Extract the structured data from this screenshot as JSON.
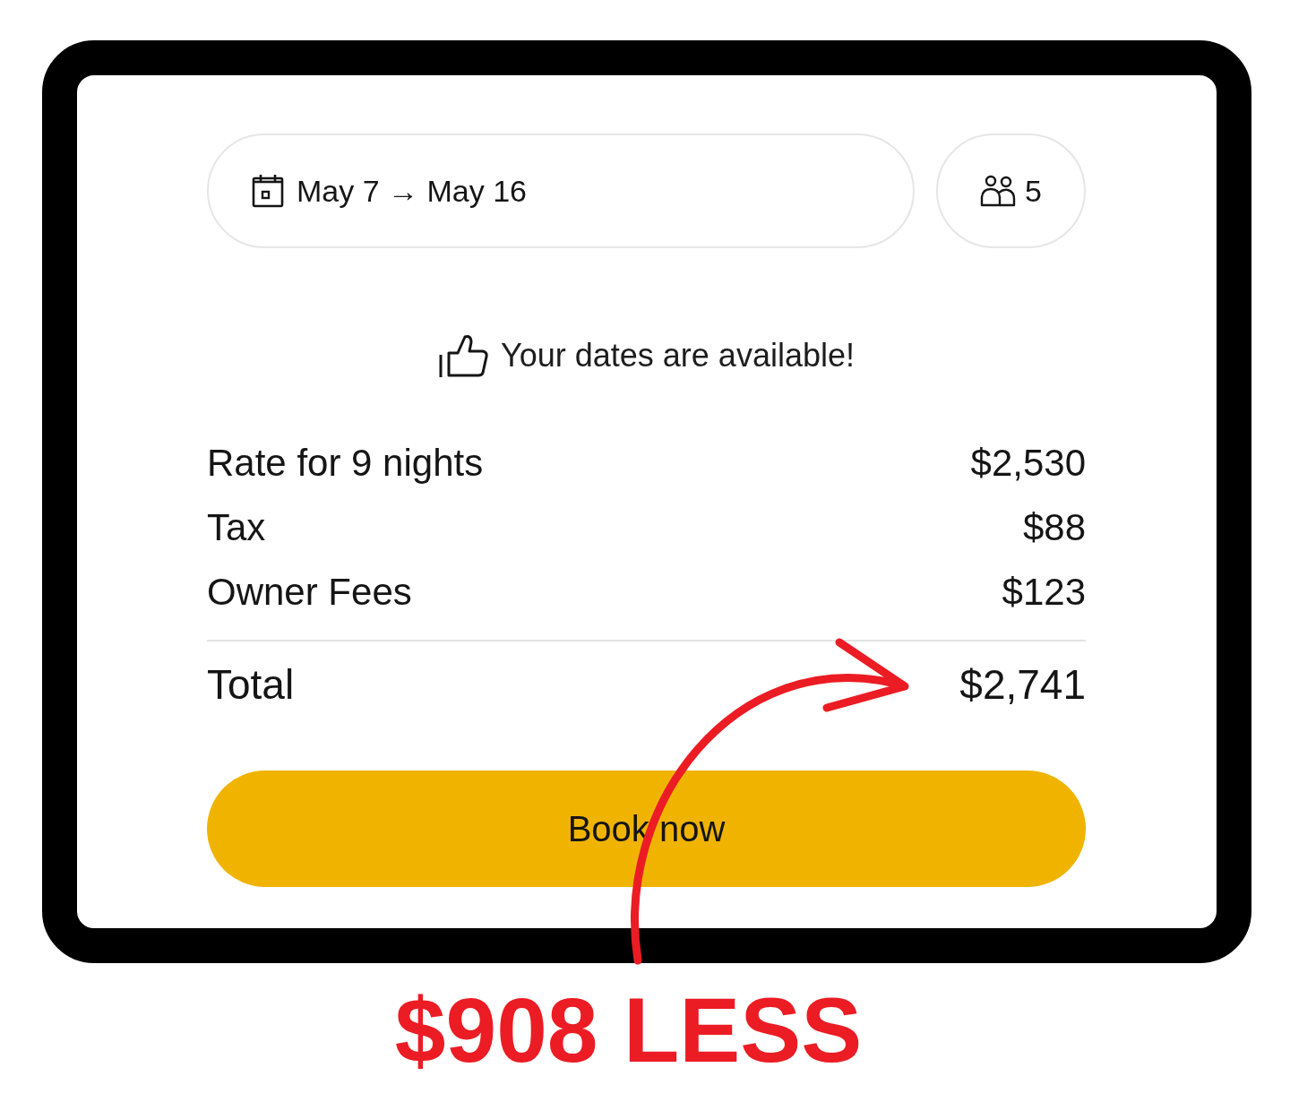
{
  "booking": {
    "dates": "May 7 → May 16",
    "guests": "5"
  },
  "availability": {
    "message": "Your dates are available!"
  },
  "price_rows": [
    {
      "label": "Rate for 9 nights",
      "value": "$2,530"
    },
    {
      "label": "Tax",
      "value": "$88"
    },
    {
      "label": "Owner Fees",
      "value": "$123"
    }
  ],
  "total": {
    "label": "Total",
    "value": "$2,741"
  },
  "book_button": {
    "label": "Book now"
  },
  "annotation": {
    "callout": "$908 LESS"
  }
}
